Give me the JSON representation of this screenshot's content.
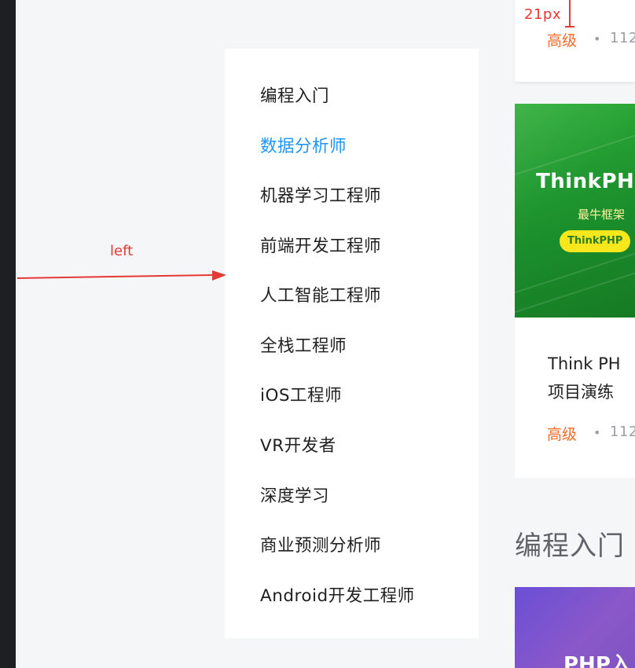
{
  "annotations": {
    "spacing_label": "21px",
    "left_label": "left",
    "color": "#e53935"
  },
  "menu": {
    "active_color": "#2196f3",
    "items": [
      {
        "label": "编程入门",
        "active": false
      },
      {
        "label": "数据分析师",
        "active": true
      },
      {
        "label": "机器学习工程师",
        "active": false
      },
      {
        "label": "前端开发工程师",
        "active": false
      },
      {
        "label": "人工智能工程师",
        "active": false
      },
      {
        "label": "全栈工程师",
        "active": false
      },
      {
        "label": "iOS工程师",
        "active": false
      },
      {
        "label": "VR开发者",
        "active": false
      },
      {
        "label": "深度学习",
        "active": false
      },
      {
        "label": "商业预测分析师",
        "active": false
      },
      {
        "label": "Android开发工程师",
        "active": false
      }
    ]
  },
  "cards": {
    "top": {
      "level": "高级",
      "separator": "•",
      "count_partial": "112"
    },
    "main": {
      "thumb_title": "ThinkPH",
      "thumb_subtitle": "最牛框架",
      "thumb_pill": "ThinkPHP",
      "title_line1": "Think PH",
      "title_line2": "项目演练",
      "level": "高级",
      "separator": "•",
      "count_partial": "112"
    },
    "bottom": {
      "thumb_title": "PHP入"
    }
  },
  "section": {
    "title": "编程入门"
  },
  "colors": {
    "level": "#f26b2b",
    "page_bg": "#f5f6f8"
  }
}
